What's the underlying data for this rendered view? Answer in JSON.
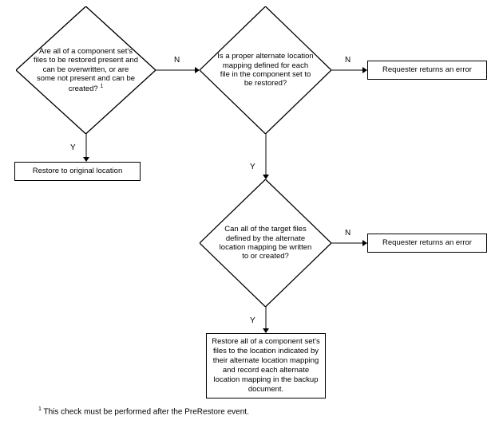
{
  "diamond1": "Are all of a component set's files to be restored present and can be overwritten, or are some not present and can be created? ",
  "diamond1_sup": "1",
  "diamond2": "Is a proper alternate location mapping defined for each file in the component set to be restored?",
  "diamond3": "Can all of the target files defined by the alternate location mapping be written to or created?",
  "box_restore_orig": "Restore to original location",
  "box_error": "Requester returns an error",
  "box_restore_alt": "Restore all of a component set's files to the location indicated by their alternate location mapping and record each alternate location mapping in the backup document.",
  "labels": {
    "Y": "Y",
    "N": "N"
  },
  "footnote_sup": "1",
  "footnote": " This check must be performed after the PreRestore event."
}
